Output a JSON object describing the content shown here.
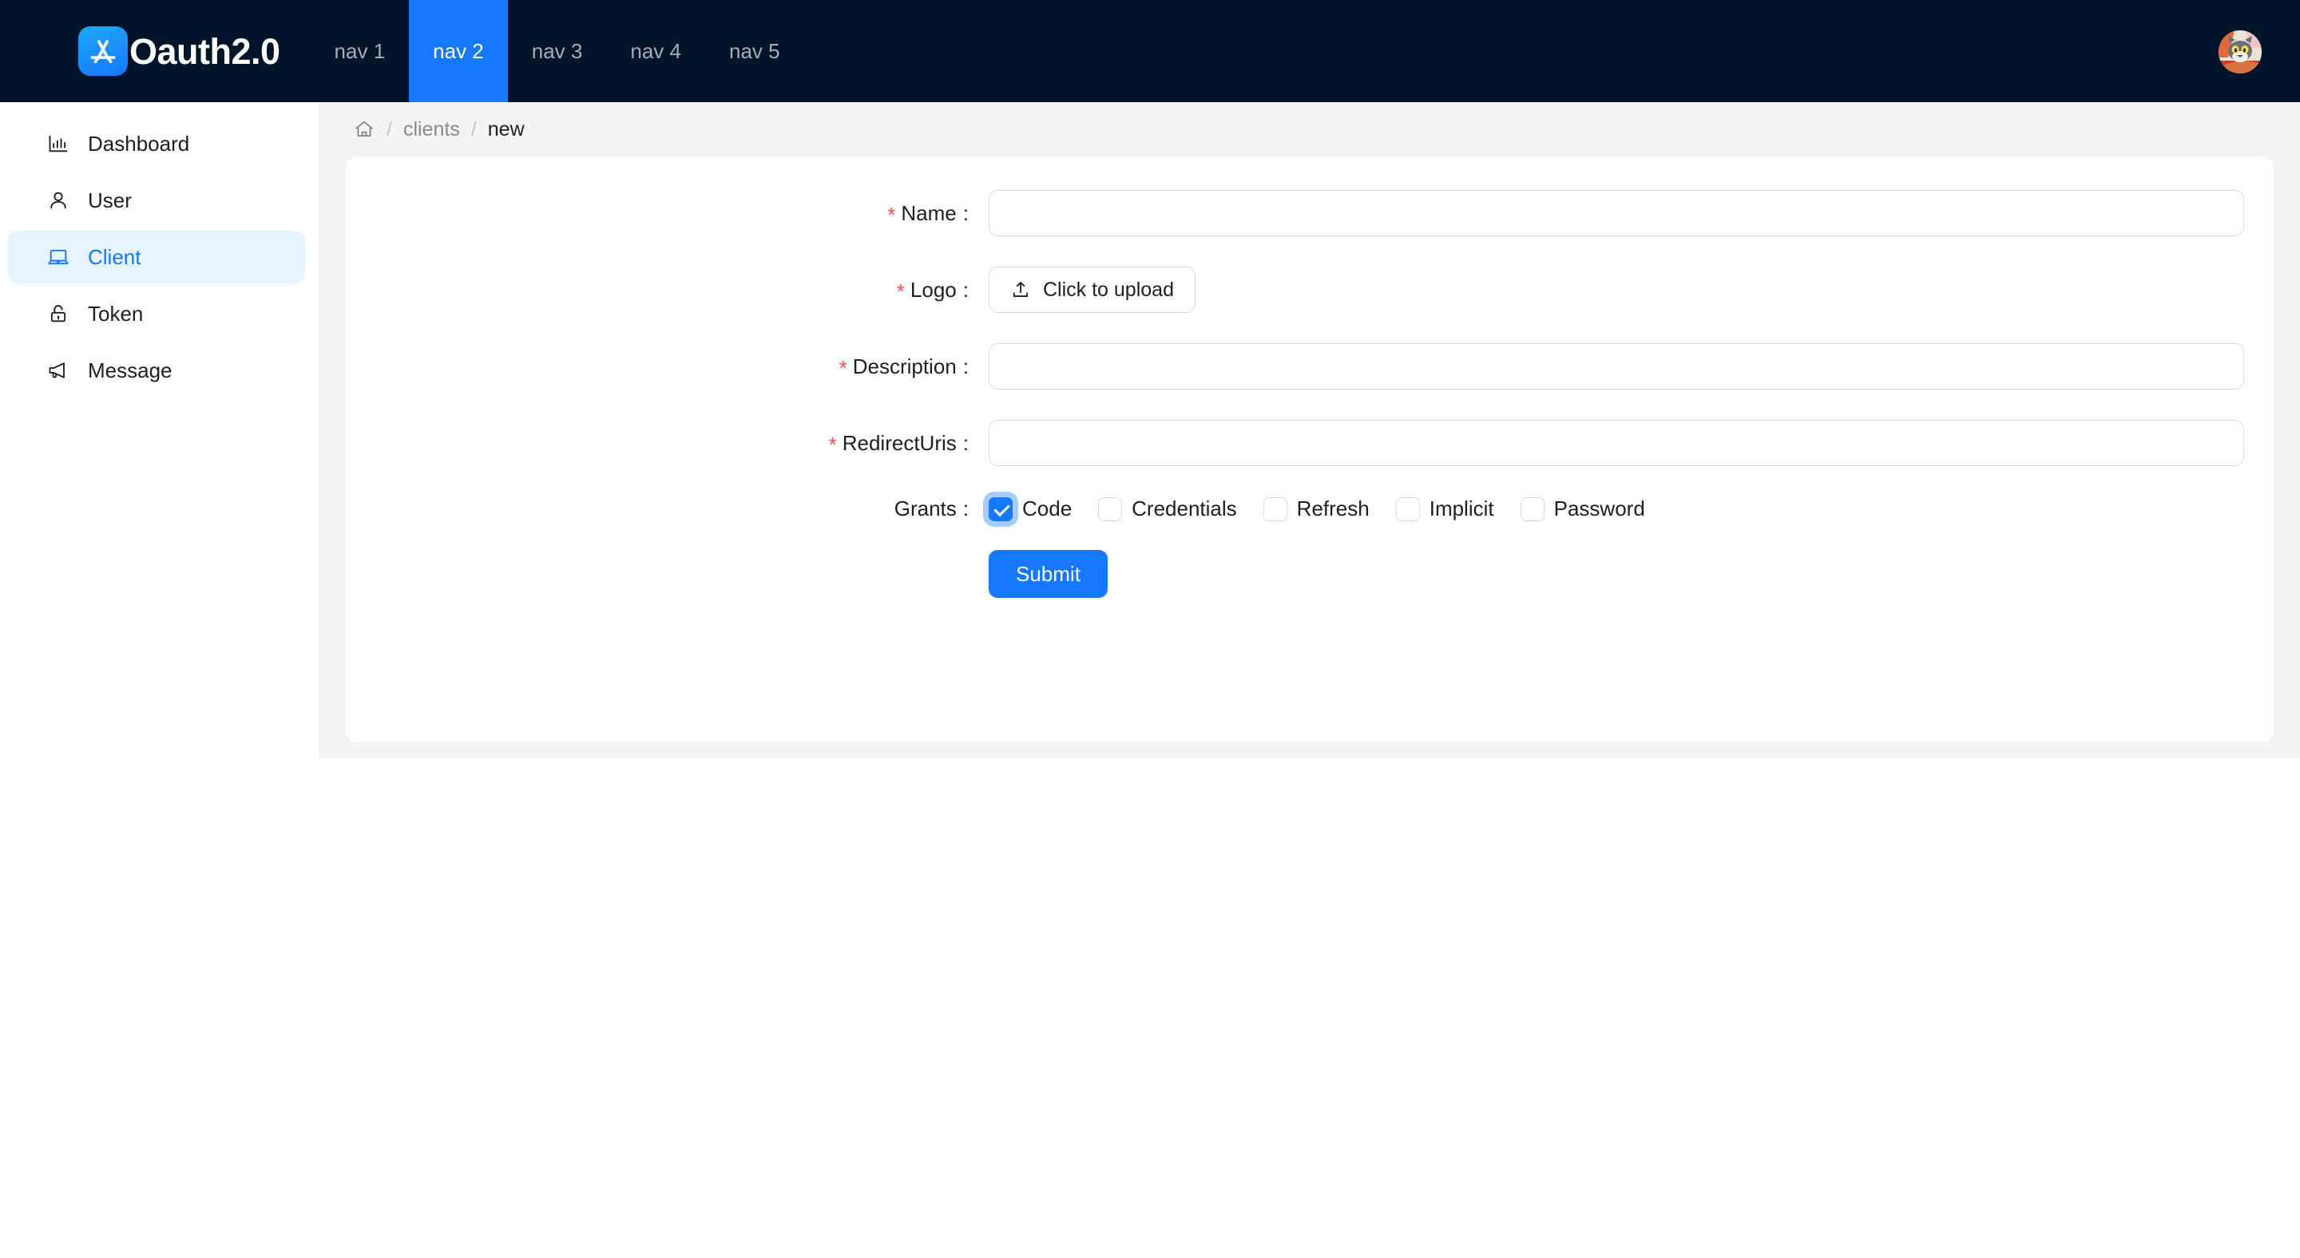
{
  "header": {
    "brand_title": "Oauth2.0",
    "brand_icon": "appstore-icon",
    "nav": [
      {
        "label": "nav 1",
        "active": false
      },
      {
        "label": "nav 2",
        "active": true
      },
      {
        "label": "nav 3",
        "active": false
      },
      {
        "label": "nav 4",
        "active": false
      },
      {
        "label": "nav 5",
        "active": false
      }
    ],
    "avatar_alt": "user-avatar",
    "background_color": "#001529",
    "active_color": "#1677ff"
  },
  "sidebar": {
    "items": [
      {
        "label": "Dashboard",
        "icon": "bar-chart-icon",
        "active": false
      },
      {
        "label": "User",
        "icon": "user-icon",
        "active": false
      },
      {
        "label": "Client",
        "icon": "laptop-icon",
        "active": true
      },
      {
        "label": "Token",
        "icon": "unlock-icon",
        "active": false
      },
      {
        "label": "Message",
        "icon": "notification-icon",
        "active": false
      }
    ],
    "active_bg": "#e6f4ff",
    "active_fg": "#1677ff"
  },
  "breadcrumb": {
    "home_icon": "home-icon",
    "separator": "/",
    "items": [
      {
        "label": "clients",
        "current": false
      },
      {
        "label": "new",
        "current": true
      }
    ]
  },
  "form": {
    "fields": [
      {
        "label": "Name",
        "required": true,
        "type": "input",
        "value": "",
        "placeholder": ""
      },
      {
        "label": "Logo",
        "required": true,
        "type": "upload",
        "button_label": "Click to upload",
        "icon": "upload-icon"
      },
      {
        "label": "Description",
        "required": true,
        "type": "input",
        "value": "",
        "placeholder": ""
      },
      {
        "label": "RedirectUris",
        "required": true,
        "type": "input",
        "value": "",
        "placeholder": ""
      }
    ],
    "grants": {
      "label": "Grants",
      "required": false,
      "options": [
        {
          "label": "Code",
          "checked": true
        },
        {
          "label": "Credentials",
          "checked": false
        },
        {
          "label": "Refresh",
          "checked": false
        },
        {
          "label": "Implicit",
          "checked": false
        },
        {
          "label": "Password",
          "checked": false
        }
      ]
    },
    "submit_label": "Submit",
    "required_marker": "*",
    "label_colon": ":",
    "required_color": "#ff4d4f",
    "primary_color": "#1677ff"
  }
}
